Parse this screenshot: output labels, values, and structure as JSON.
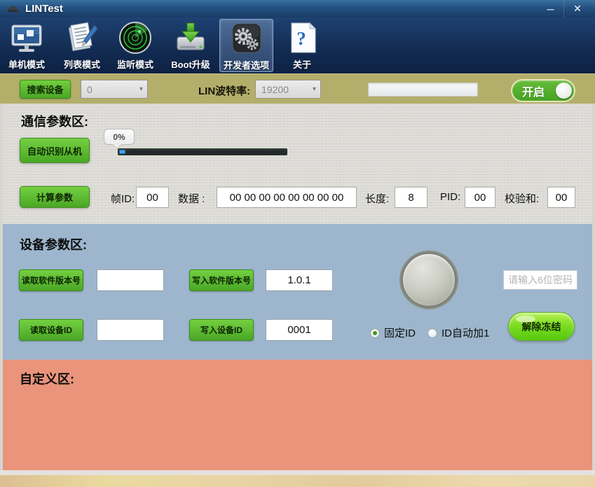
{
  "window": {
    "title": "LINTest",
    "minimize_glyph": "─",
    "close_glyph": "✕"
  },
  "toolbar": {
    "items": [
      {
        "label": "单机模式",
        "icon": "monitor-icon",
        "selected": false
      },
      {
        "label": "列表模式",
        "icon": "list-icon",
        "selected": false
      },
      {
        "label": "监听模式",
        "icon": "radar-icon",
        "selected": false
      },
      {
        "label": "Boot升级",
        "icon": "boot-upgrade-icon",
        "selected": false
      },
      {
        "label": "开发者选项",
        "icon": "gears-icon",
        "selected": true
      },
      {
        "label": "关于",
        "icon": "about-icon",
        "selected": false
      }
    ]
  },
  "device_bar": {
    "search_button": "搜索设备",
    "device_select_value": "0",
    "baud_label": "LIN波特率:",
    "baud_select_value": "19200",
    "dropdown_arrow": "▾",
    "status_field_value": "",
    "toggle_label": "开启",
    "toggle_state": "on"
  },
  "comm_section": {
    "title": "通信参数区:",
    "auto_detect_button": "自动识别从机",
    "progress_tooltip": "0%",
    "progress_percent": 0,
    "calc_button": "计算参数",
    "frame_id_label": "帧ID:",
    "frame_id_value": "00",
    "data_label": "数据 :",
    "data_value": "00 00 00 00 00 00 00 00",
    "length_label": "长度:",
    "length_value": "8",
    "pid_label": "PID:",
    "pid_value": "00",
    "checksum_label": "校验和:",
    "checksum_value": "00"
  },
  "device_section": {
    "title": "设备参数区:",
    "read_sw_button": "读取软件版本号",
    "read_sw_value": "",
    "write_sw_button": "写入软件版本号",
    "write_sw_value": "1.0.1",
    "read_id_button": "读取设备ID",
    "read_id_value": "",
    "write_id_button": "写入设备ID",
    "write_id_value": "0001",
    "radio_fixed_label": "固定ID",
    "radio_fixed_checked": true,
    "radio_auto_label": "ID自动加1",
    "radio_auto_checked": false,
    "password_placeholder": "请输入6位密码",
    "unfreeze_button": "解除冻结"
  },
  "custom_section": {
    "title": "自定义区:"
  },
  "colors": {
    "titlebar_blue": "#24507f",
    "toolbar_navy": "#132c53",
    "olive_bar": "#b3ae6a",
    "button_green": "#4aa725",
    "toggle_green": "#46a324",
    "comm_gray": "#dbdad5",
    "device_blue": "#9db6cd",
    "custom_salmon": "#e9947b",
    "slider_handle_blue": "#4aa0e6",
    "unfreeze_lime": "#7edd24"
  }
}
